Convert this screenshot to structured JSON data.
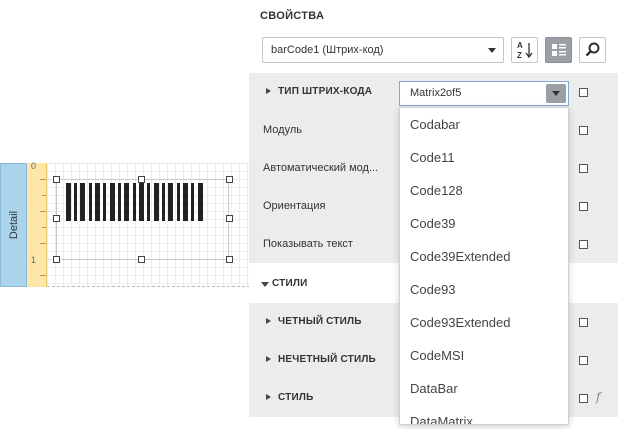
{
  "designer": {
    "band_label": "Detail",
    "ruler_marks": [
      "0",
      "1"
    ]
  },
  "panel": {
    "title": "СВОЙСТВА",
    "object_selector": "barCode1 (Штрих-код)",
    "buttons": {
      "sort": "sort-az-icon",
      "categories": "categories-icon",
      "search": "search-icon"
    }
  },
  "properties": {
    "barcode_type_label": "ТИП ШТРИХ-КОДА",
    "barcode_type_value": "Matrix2of5",
    "module_label": "Модуль",
    "auto_module_label": "Автоматический мод...",
    "orientation_label": "Ориентация",
    "show_text_label": "Показывать текст",
    "styles_section": "СТИЛИ",
    "even_style_label": "ЧЕТНЫЙ СТИЛЬ",
    "odd_style_label": "НЕЧЕТНЫЙ СТИЛЬ",
    "style_label": "СТИЛЬ",
    "fx_symbol": "f"
  },
  "dropdown_options": [
    "Codabar",
    "Code11",
    "Code128",
    "Code39",
    "Code39Extended",
    "Code93",
    "Code93Extended",
    "CodeMSI",
    "DataBar",
    "DataMatrix"
  ]
}
